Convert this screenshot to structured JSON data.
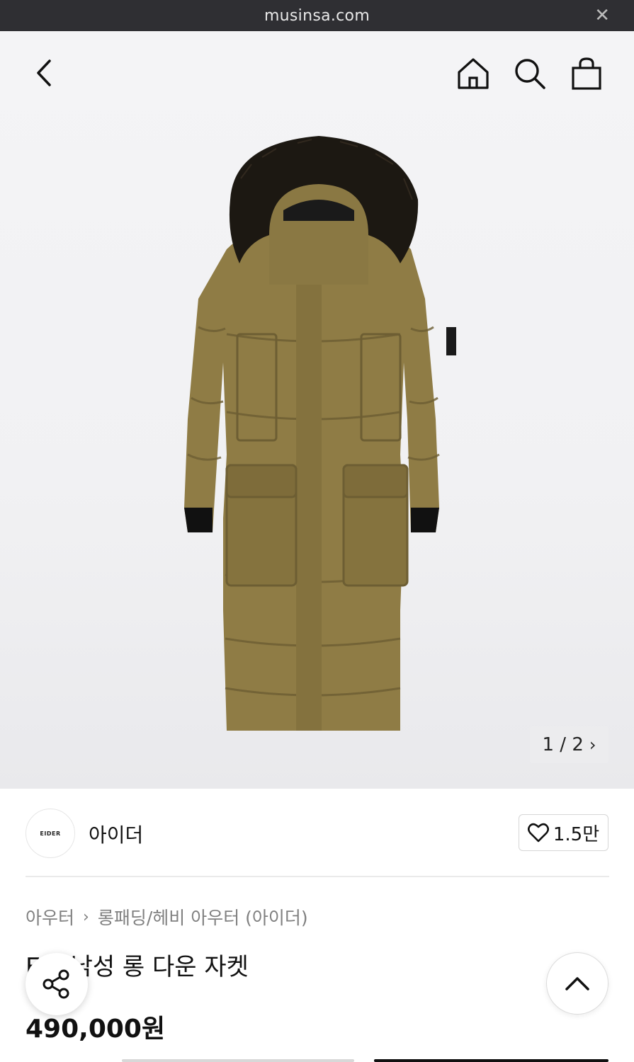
{
  "browser": {
    "url": "musinsa.com",
    "close_icon": "close-icon"
  },
  "nav": {
    "back_icon": "chevron-left-icon",
    "home_icon": "home-icon",
    "search_icon": "search-icon",
    "bag_icon": "shopping-bag-icon"
  },
  "gallery": {
    "image": "long-down-jacket-photo",
    "pager_text": "1 / 2",
    "pager_icon": "chevron-right-icon"
  },
  "brand": {
    "logo_text": "EIDER",
    "name": "아이더",
    "like_icon": "heart-icon",
    "like_count": "1.5만"
  },
  "breadcrumb": {
    "level1": "아우터",
    "level2": "롱패딩/헤비 아우터 (아이더)"
  },
  "product": {
    "title": "E스 남성 롱 다운 자켓",
    "price": "490,000원"
  },
  "floating": {
    "share_icon": "share-icon",
    "top_icon": "chevron-up-icon"
  },
  "colors": {
    "urlbar_bg": "#2f2f33",
    "jacket": "#8f7c45",
    "fur": "#1c1812"
  }
}
